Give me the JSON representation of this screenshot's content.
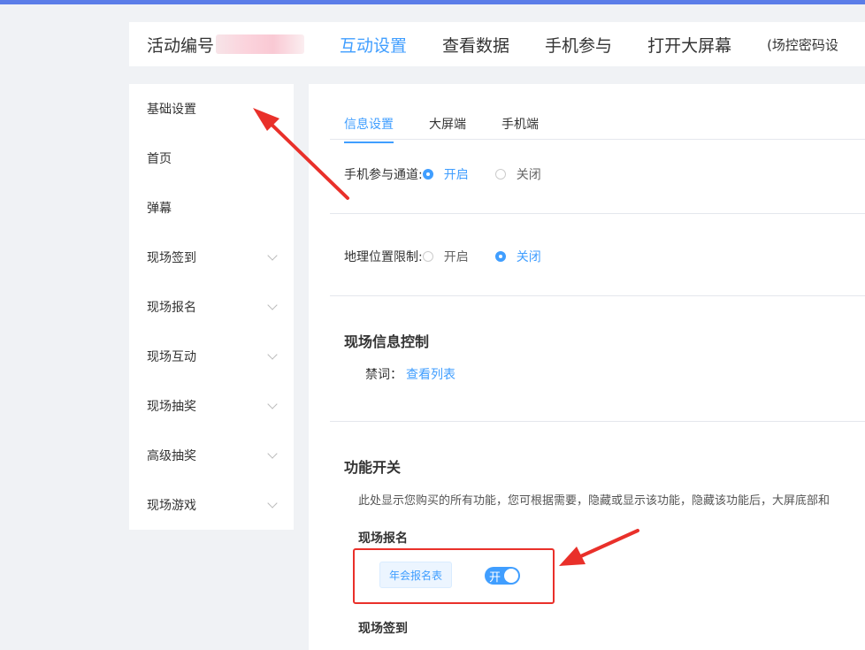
{
  "header": {
    "activity_label": "活动编号",
    "nav": [
      "互动设置",
      "查看数据",
      "手机参与",
      "打开大屏幕"
    ],
    "password_note": "(场控密码设"
  },
  "sidebar": {
    "items": [
      {
        "label": "基础设置",
        "expand": false
      },
      {
        "label": "首页",
        "expand": false
      },
      {
        "label": "弹幕",
        "expand": false
      },
      {
        "label": "现场签到",
        "expand": true
      },
      {
        "label": "现场报名",
        "expand": true
      },
      {
        "label": "现场互动",
        "expand": true
      },
      {
        "label": "现场抽奖",
        "expand": true
      },
      {
        "label": "高级抽奖",
        "expand": true
      },
      {
        "label": "现场游戏",
        "expand": true
      }
    ]
  },
  "tabs": [
    "信息设置",
    "大屏端",
    "手机端"
  ],
  "settings": {
    "mobile_channel": {
      "label": "手机参与通道:",
      "on": "开启",
      "off": "关闭",
      "selected": "on"
    },
    "geo_limit": {
      "label": "地理位置限制:",
      "on": "开启",
      "off": "关闭",
      "selected": "off"
    }
  },
  "info_control": {
    "title": "现场信息控制",
    "ban_label": "禁词：",
    "ban_link": "查看列表"
  },
  "features": {
    "title": "功能开关",
    "description": "此处显示您购买的所有功能，您可根据需要，隐藏或显示该功能，隐藏该功能后，大屏底部和",
    "signup": {
      "title": "现场报名",
      "form_button": "年会报名表",
      "switch_text": "开",
      "switch_on": true
    },
    "checkin_title": "现场签到"
  },
  "colors": {
    "accent": "#409eff",
    "annotation": "#e9302a",
    "top_stripe": "#5b7de8"
  }
}
